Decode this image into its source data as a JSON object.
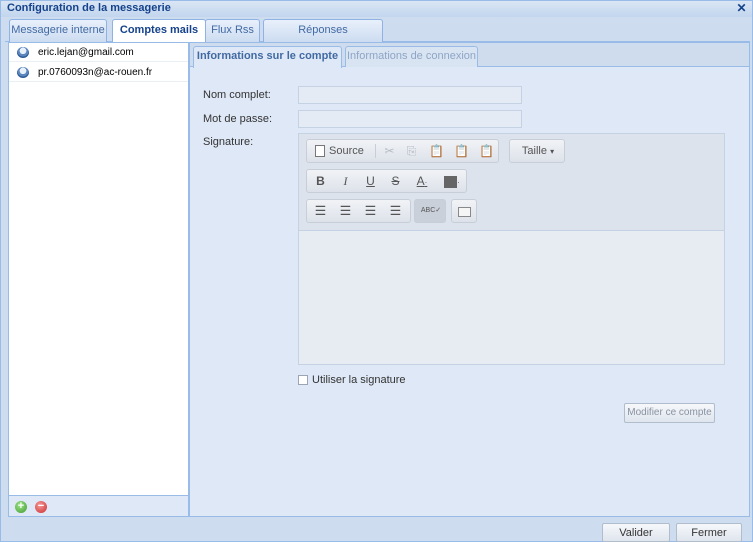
{
  "window": {
    "title": "Configuration de la messagerie",
    "close_glyph": "✕"
  },
  "tabs": [
    {
      "label": "Messagerie interne",
      "active": false
    },
    {
      "label": "Comptes mails",
      "active": true
    },
    {
      "label": "Flux Rss",
      "active": false
    },
    {
      "label": "Réponses Automatiques",
      "active": false
    }
  ],
  "accounts": [
    {
      "label": "eric.lejan@gmail.com",
      "icon": "mail-account-icon"
    },
    {
      "label": "pr.0760093n@ac-rouen.fr",
      "icon": "mail-account-icon"
    }
  ],
  "left_footer": {
    "add_icon": "add-icon",
    "remove_icon": "remove-icon"
  },
  "subtabs": [
    {
      "label": "Informations sur le compte",
      "active": true
    },
    {
      "label": "Informations de connexion",
      "active": false
    }
  ],
  "form": {
    "full_name_label": "Nom complet:",
    "full_name_value": "",
    "password_label": "Mot de passe:",
    "password_value": "",
    "signature_label": "Signature:",
    "use_signature_label": "Utiliser la signature",
    "use_signature_checked": false,
    "modify_button": "Modifier ce compte"
  },
  "editor_toolbar": {
    "source_label": "Source",
    "size_label": "Taille",
    "bold": "B",
    "italic": "I",
    "underline": "U",
    "strike": "S",
    "text_color": "A",
    "spellcheck": "ABC"
  },
  "footer": {
    "validate": "Valider",
    "close": "Fermer"
  },
  "colors": {
    "accent": "#15428b",
    "panel_bg": "#dfe8f6",
    "border": "#99bbe8"
  }
}
